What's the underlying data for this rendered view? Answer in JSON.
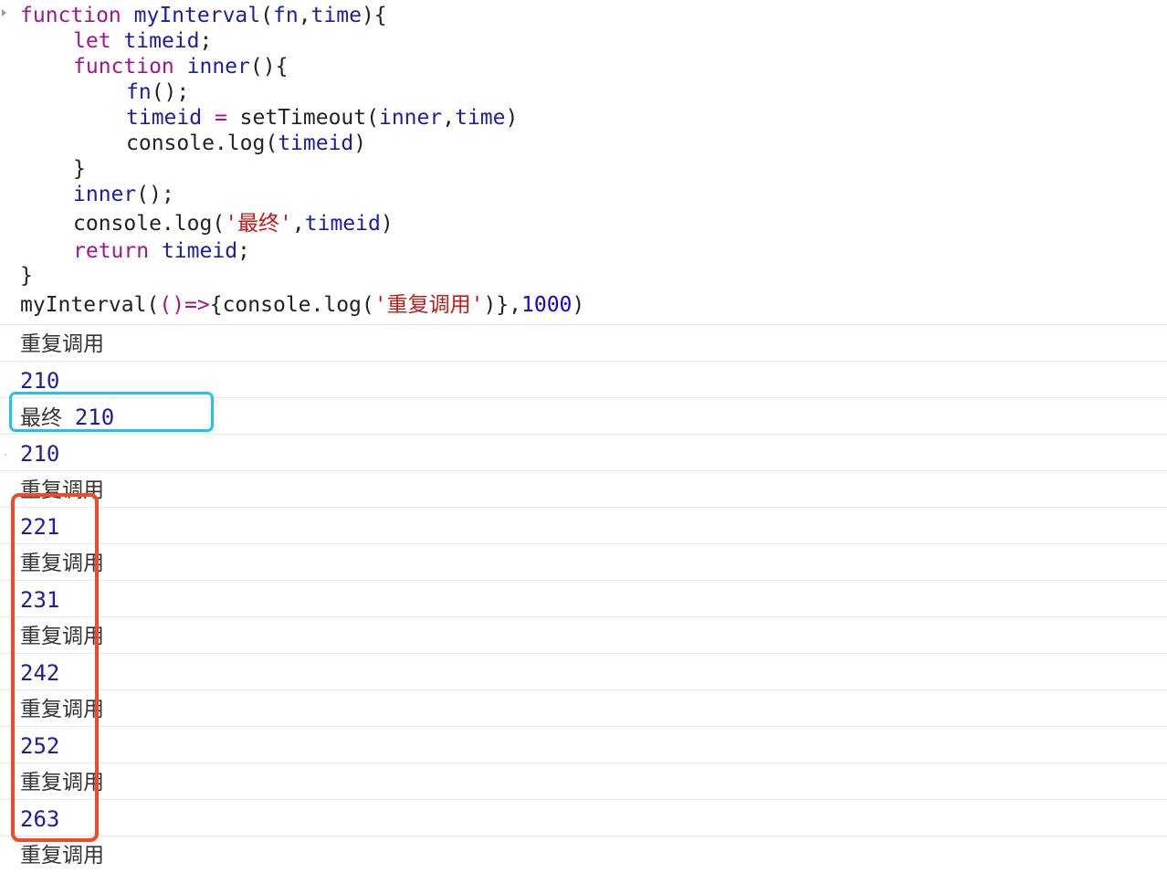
{
  "code": {
    "line1": {
      "kw": "function",
      "name": "myInterval",
      "open": "(",
      "p1": "fn",
      "comma": ",",
      "p2": "time",
      "close": "){"
    },
    "line2": {
      "kw": "let",
      "var": "timeid",
      "semi": ";"
    },
    "line3": {
      "kw": "function",
      "name": "inner",
      "rest": "(){"
    },
    "line4": {
      "call": "fn",
      "rest": "();"
    },
    "line5": {
      "var": "timeid",
      "eq": " = ",
      "call": "setTimeout",
      "open": "(",
      "a1": "inner",
      "comma": ",",
      "a2": "time",
      "close": ")"
    },
    "line6": {
      "call": "console.log",
      "open": "(",
      "arg": "timeid",
      "close": ")"
    },
    "line7": {
      "brace": "}"
    },
    "line8": {
      "call": "inner",
      "rest": "();"
    },
    "line9": {
      "call": "console.log",
      "open": "(",
      "str": "'最终'",
      "comma": ",",
      "arg": "timeid",
      "close": ")"
    },
    "line10": {
      "kw": "return",
      "var": "timeid",
      "semi": ";"
    },
    "line11": {
      "brace": "}"
    },
    "line12": {
      "call": "myInterval",
      "open": "(",
      "arrow": "()=>",
      "body_open": "{console.log(",
      "str": "'重复调用'",
      "body_close": ")}",
      "comma": ",",
      "num": "1000",
      "close": ")"
    }
  },
  "output": [
    {
      "text": "重复调用"
    },
    {
      "text": "210"
    },
    {
      "label": "最终",
      "value": "210"
    },
    {
      "text": "210"
    },
    {
      "text": "重复调用"
    },
    {
      "text": "221"
    },
    {
      "text": "重复调用"
    },
    {
      "text": "231"
    },
    {
      "text": "重复调用"
    },
    {
      "text": "242"
    },
    {
      "text": "重复调用"
    },
    {
      "text": "252"
    },
    {
      "text": "重复调用"
    },
    {
      "text": "263"
    },
    {
      "text": "重复调用"
    }
  ],
  "colors": {
    "keyword": "#a3148d",
    "identifier": "#1c1ca8",
    "string": "#c41a16",
    "number": "#1c00cf",
    "highlight_blue": "#1ec3ef",
    "highlight_red": "#ef4a2a"
  }
}
